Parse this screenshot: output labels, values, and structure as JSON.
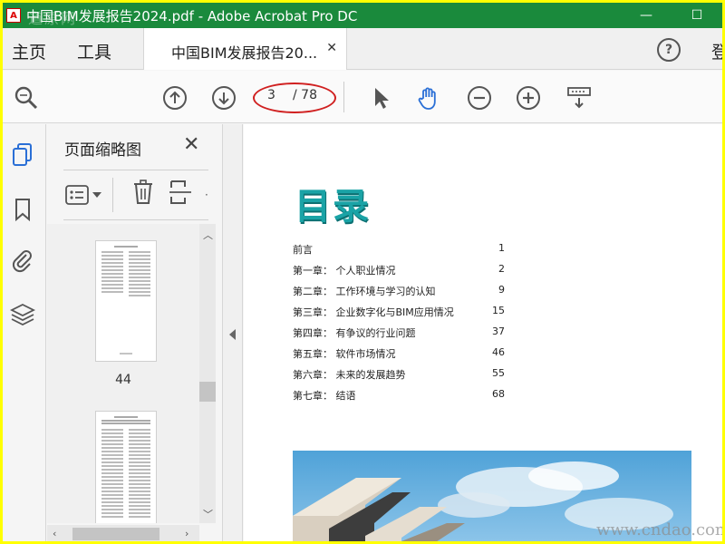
{
  "window": {
    "title": "中国BIM发展报告2024.pdf - Adobe Acrobat Pro DC",
    "watermark_top": "道原网",
    "minimize": "—",
    "maximize": "☐"
  },
  "tabbar": {
    "home": "主页",
    "tools": "工具",
    "doc_tab": "中国BIM发展报告20...",
    "doc_tab_close": "✕",
    "help": "?",
    "signin": "登"
  },
  "toolbar": {
    "current_page": "3",
    "total_pages": "/ 78"
  },
  "thumbnails": {
    "title": "页面缩略图",
    "close": "✕",
    "pages": [
      {
        "number": "44"
      },
      {
        "number": ""
      }
    ]
  },
  "document": {
    "toc_title": "目录",
    "toc": [
      {
        "label": "前言",
        "page": "1"
      },
      {
        "label": "第一章：  个人职业情况",
        "page": "2"
      },
      {
        "label": "第二章：  工作环境与学习的认知",
        "page": "9"
      },
      {
        "label": "第三章：  企业数字化与BIM应用情况",
        "page": "15"
      },
      {
        "label": "第四章：  有争议的行业问题",
        "page": "37"
      },
      {
        "label": "第五章：  软件市场情况",
        "page": "46"
      },
      {
        "label": "第六章：  未来的发展趋势",
        "page": "55"
      },
      {
        "label": "第七章：  结语",
        "page": "68"
      }
    ]
  },
  "watermark_bottom": "www.cndao.com",
  "colors": {
    "titlebar": "#1a8a3c",
    "frame": "#ffff00",
    "accent_blue": "#2a6fd6",
    "toc_title": "#1aa3a6",
    "annotation_red": "#d02020"
  }
}
